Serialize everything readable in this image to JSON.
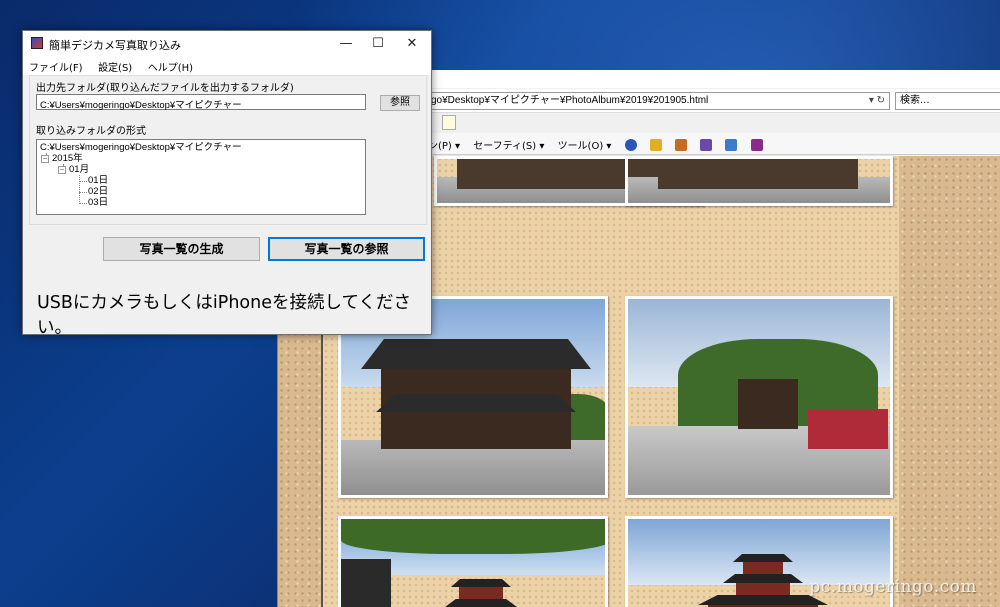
{
  "browser": {
    "address": "go¥Desktop¥マイピクチャー¥PhotoAlbum¥2019¥201905.html",
    "search_placeholder": "検索...",
    "commands": [
      "ン(P) ▾",
      "セーフティ(S) ▾",
      "ツール(O) ▾"
    ],
    "watermark": "pc.mogeringo.com"
  },
  "app": {
    "title": "簡単デジカメ写真取り込み",
    "window_controls": {
      "minimize": "—",
      "maximize": "☐",
      "close": "✕"
    },
    "menu": [
      "ファイル(F)",
      "設定(S)",
      "ヘルプ(H)"
    ],
    "output_label": "出力先フォルダ(取り込んだファイルを出力するフォルダ)",
    "output_path": "C:¥Users¥mogeringo¥Desktop¥マイピクチャー",
    "browse_label": "参照",
    "format_label": "取り込みフォルダの形式",
    "tree": {
      "root": "C:¥Users¥mogeringo¥Desktop¥マイピクチャー",
      "year": "2015年",
      "month": "01月",
      "days": [
        "01日",
        "02日",
        "03日"
      ]
    },
    "generate_button": "写真一覧の生成",
    "view_button": "写真一覧の参照",
    "status": "USBにカメラもしくはiPhoneを接続してください。"
  }
}
